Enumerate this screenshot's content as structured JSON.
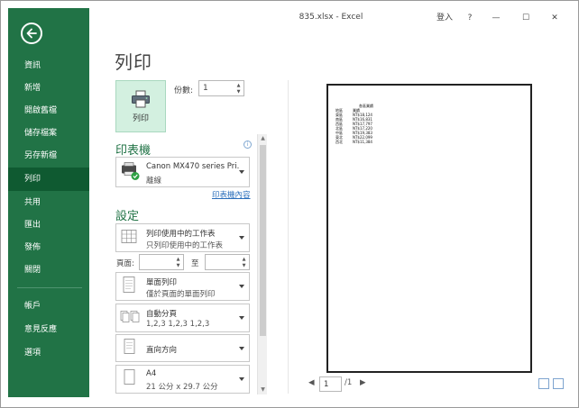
{
  "window": {
    "title": "835.xlsx - Excel",
    "signin": "登入",
    "help": "?",
    "minimize": "—",
    "maximize": "☐",
    "close": "✕"
  },
  "sidebar": {
    "items": [
      {
        "label": "資訊"
      },
      {
        "label": "新增"
      },
      {
        "label": "開啟舊檔"
      },
      {
        "label": "儲存檔案"
      },
      {
        "label": "另存新檔"
      },
      {
        "label": "列印",
        "active": true
      },
      {
        "label": "共用"
      },
      {
        "label": "匯出"
      },
      {
        "label": "發佈"
      },
      {
        "label": "關閉"
      },
      {
        "label": "帳戶"
      },
      {
        "label": "意見反應"
      },
      {
        "label": "選項"
      }
    ]
  },
  "main": {
    "heading": "列印",
    "print_button": "列印",
    "copies_label": "份數:",
    "copies_value": "1",
    "printer_section": "印表機",
    "printer": {
      "name": "Canon MX470 series Pri...",
      "status": "離線",
      "properties_link": "印表機內容"
    },
    "settings_section": "設定",
    "settings": {
      "scope_title": "列印使用中的工作表",
      "scope_desc": "只列印使用中的工作表",
      "pages_label": "頁面:",
      "to_label": "至",
      "sides_title": "單面列印",
      "sides_desc": "僅於頁面的單面列印",
      "collate_title": "自動分頁",
      "collate_desc": "1,2,3   1,2,3   1,2,3",
      "orientation": "直向方向",
      "paper_title": "A4",
      "paper_desc": "21 公分 x 29.7 公分"
    }
  },
  "preview": {
    "header": "各區業績",
    "columns": [
      "地區",
      "業績"
    ],
    "rows": [
      [
        "東區",
        "NT$18,124"
      ],
      [
        "南區",
        "NT$16,831"
      ],
      [
        "西區",
        "NT$17,797"
      ],
      [
        "北區",
        "NT$17,220"
      ],
      [
        "中區",
        "NT$19,383"
      ],
      [
        "東北",
        "NT$22,099"
      ],
      [
        "西北",
        "NT$11,384"
      ]
    ],
    "page_current": "1",
    "page_total": "/1"
  },
  "colors": {
    "brand": "#217346",
    "active_nav": "#0f5a31",
    "print_button_bg": "#d3f0e0",
    "link": "#2a6ebb"
  }
}
